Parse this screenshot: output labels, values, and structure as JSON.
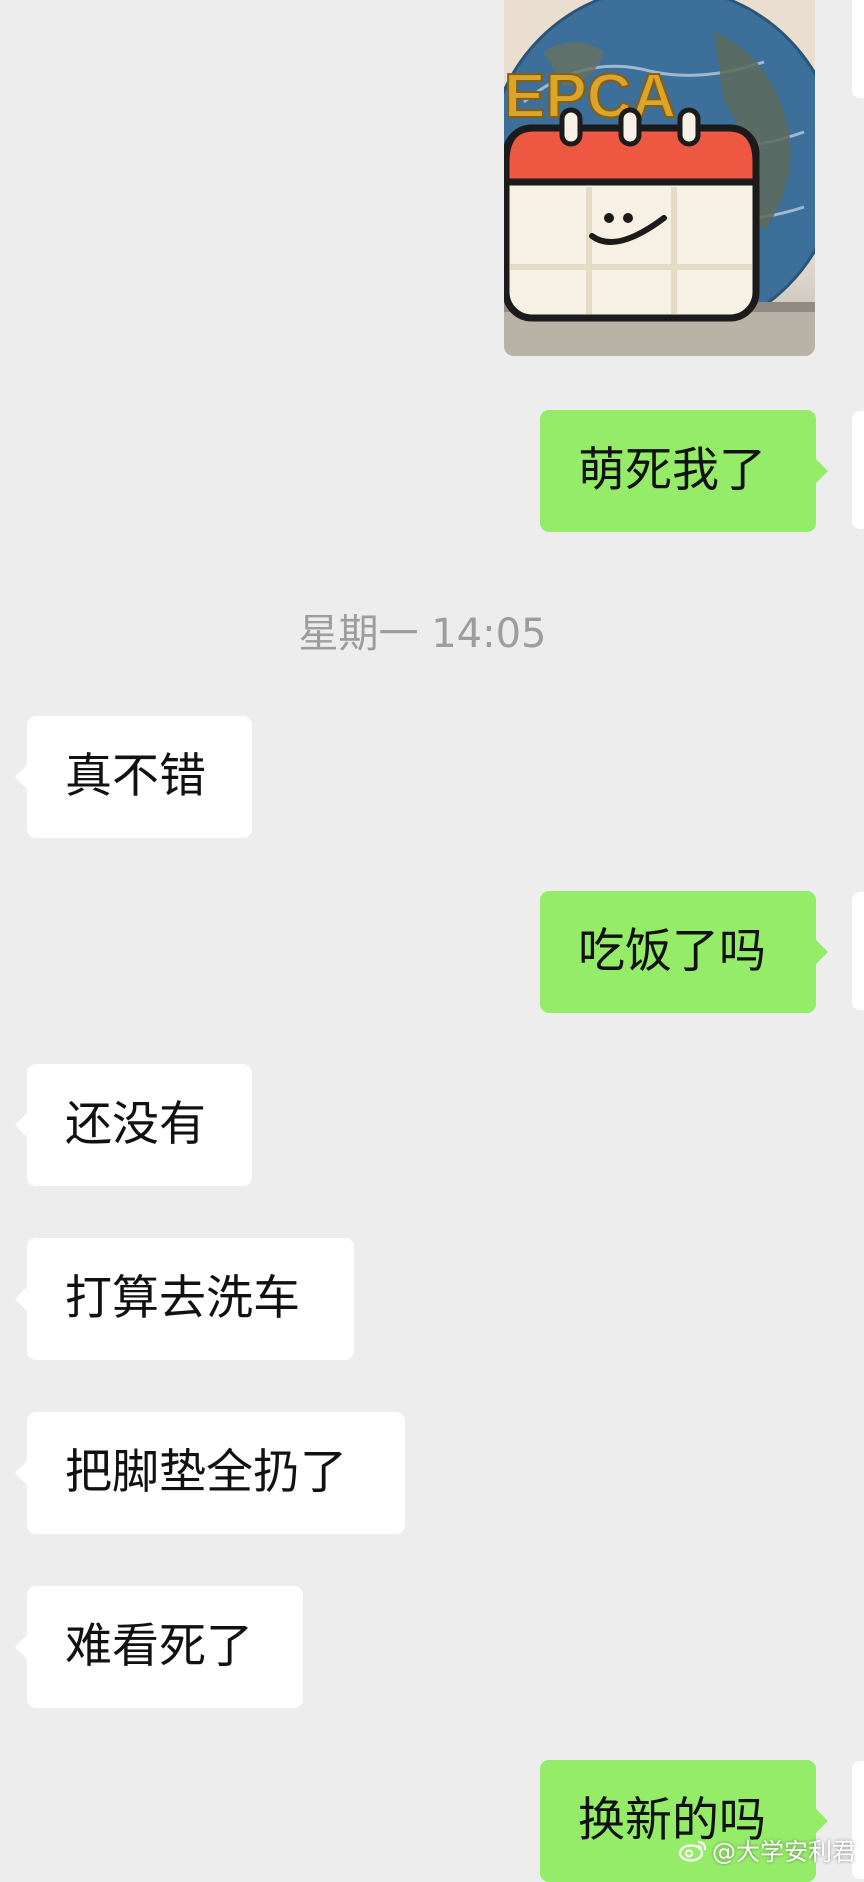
{
  "chat": {
    "photo_text": "EPCA",
    "timestamp": "星期一 14:05",
    "messages": [
      {
        "side": "out",
        "text": "萌死我了"
      },
      {
        "side": "in",
        "text": "真不错"
      },
      {
        "side": "out",
        "text": "吃饭了吗"
      },
      {
        "side": "in",
        "text": "还没有"
      },
      {
        "side": "in",
        "text": "打算去洗车"
      },
      {
        "side": "in",
        "text": "把脚垫全扔了"
      },
      {
        "side": "in",
        "text": "难看死了"
      },
      {
        "side": "out",
        "text": "换新的吗"
      }
    ]
  },
  "watermark": {
    "text": "@大学安利君",
    "icon": "weibo-icon"
  },
  "colors": {
    "background": "#ededed",
    "outgoing_bubble": "#95ec69",
    "incoming_bubble": "#ffffff",
    "timestamp_text": "#9d9d9d"
  }
}
